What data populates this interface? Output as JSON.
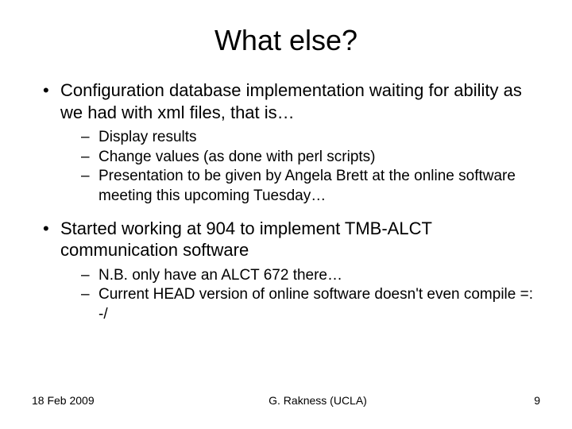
{
  "title": "What else?",
  "bullets": [
    {
      "text": "Configuration database implementation waiting for ability as we had with xml files, that is…",
      "sub": [
        "Display results",
        "Change values (as done with perl scripts)",
        "Presentation to be given by Angela Brett at the online software meeting this upcoming Tuesday…"
      ]
    },
    {
      "text": "Started working at 904 to implement TMB-ALCT communication software",
      "sub": [
        "N.B. only have an ALCT 672 there…",
        "Current HEAD version of online software doesn't even compile   =: -/"
      ]
    }
  ],
  "footer": {
    "date": "18 Feb 2009",
    "author": "G. Rakness (UCLA)",
    "page": "9"
  }
}
